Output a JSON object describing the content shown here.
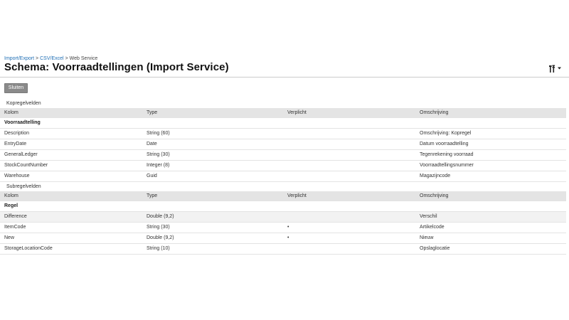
{
  "breadcrumb": {
    "items": [
      {
        "label": "Import/Export",
        "link": true
      },
      {
        "label": "CSV/Excel",
        "link": true
      },
      {
        "label": "Web Service",
        "link": false
      }
    ],
    "separator": ">"
  },
  "page_title": "Schema: Voorraadtellingen (Import Service)",
  "toolbar": {
    "tools_icon": "tools-icon",
    "dropdown_icon": "caret-down-icon"
  },
  "close_button": "Sluiten",
  "header_section": {
    "caption": "Kopregelvelden",
    "columns": [
      "Kolom",
      "Type",
      "Verplicht",
      "Omschrijving"
    ],
    "group": "Voorraadtelling",
    "rows": [
      {
        "kolom": "Description",
        "type": "String (60)",
        "verplicht": "",
        "omschrijving": "Omschrijving: Kopregel"
      },
      {
        "kolom": "EntryDate",
        "type": "Date",
        "verplicht": "",
        "omschrijving": "Datum voorraadtelling"
      },
      {
        "kolom": "GeneralLedger",
        "type": "String (30)",
        "verplicht": "",
        "omschrijving": "Tegenrekening voorraad"
      },
      {
        "kolom": "StockCountNumber",
        "type": "Integer (8)",
        "verplicht": "",
        "omschrijving": "Voorraadtellingsnummer"
      },
      {
        "kolom": "Warehouse",
        "type": "Guid",
        "verplicht": "",
        "omschrijving": "Magazijncode"
      }
    ]
  },
  "line_section": {
    "caption": "Subregelvelden",
    "columns": [
      "Kolom",
      "Type",
      "Verplicht",
      "Omschrijving"
    ],
    "group": "Regel",
    "rows": [
      {
        "kolom": "Difference",
        "type": "Double (9,2)",
        "verplicht": "",
        "omschrijving": "Verschil"
      },
      {
        "kolom": "ItemCode",
        "type": "String (30)",
        "verplicht": "•",
        "omschrijving": "Artikelcode"
      },
      {
        "kolom": "New",
        "type": "Double (9,2)",
        "verplicht": "•",
        "omschrijving": "Nieuw"
      },
      {
        "kolom": "StorageLocationCode",
        "type": "String (10)",
        "verplicht": "",
        "omschrijving": "Opslaglocatie"
      }
    ]
  },
  "colors": {
    "link": "#1f6fb5",
    "button": "#8a8a8a",
    "header_row": "#e4e4e4",
    "alt_row": "#f2f2f2"
  }
}
